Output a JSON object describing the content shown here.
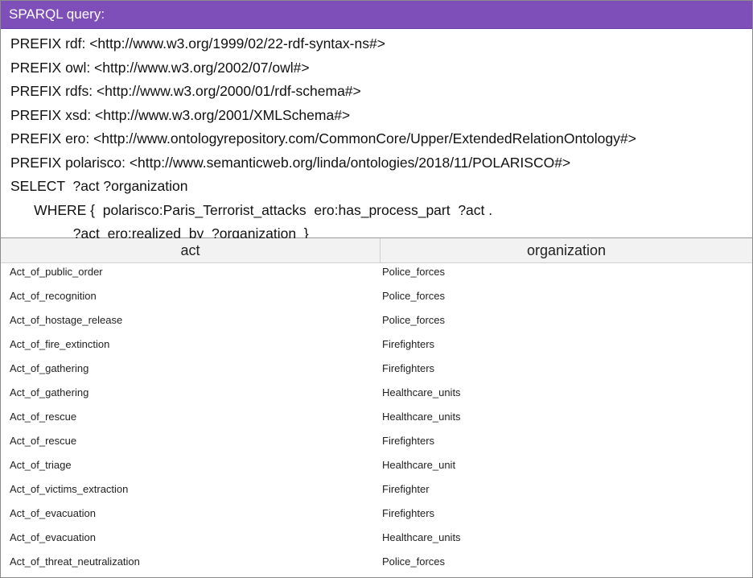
{
  "title": "SPARQL query:",
  "query_lines": [
    "PREFIX rdf: <http://www.w3.org/1999/02/22-rdf-syntax-ns#>",
    "PREFIX owl: <http://www.w3.org/2002/07/owl#>",
    "PREFIX rdfs: <http://www.w3.org/2000/01/rdf-schema#>",
    "PREFIX xsd: <http://www.w3.org/2001/XMLSchema#>",
    "PREFIX ero: <http://www.ontologyrepository.com/CommonCore/Upper/ExtendedRelationOntology#>",
    "PREFIX polarisco: <http://www.semanticweb.org/linda/ontologies/2018/11/POLARISCO#>",
    "SELECT  ?act ?organization",
    "      WHERE {  polarisco:Paris_Terrorist_attacks  ero:has_process_part  ?act .",
    "                ?act  ero:realized_by  ?organization  }"
  ],
  "columns": [
    "act",
    "organization"
  ],
  "rows": [
    [
      "Act_of_public_order",
      "Police_forces"
    ],
    [
      "Act_of_recognition",
      "Police_forces"
    ],
    [
      "Act_of_hostage_release",
      "Police_forces"
    ],
    [
      "Act_of_fire_extinction",
      "Firefighters"
    ],
    [
      "Act_of_gathering",
      "Firefighters"
    ],
    [
      "Act_of_gathering",
      "Healthcare_units"
    ],
    [
      "Act_of_rescue",
      "Healthcare_units"
    ],
    [
      "Act_of_rescue",
      "Firefighters"
    ],
    [
      "Act_of_triage",
      "Healthcare_unit"
    ],
    [
      "Act_of_victims_extraction",
      "Firefighter"
    ],
    [
      "Act_of_evacuation",
      "Firefighters"
    ],
    [
      "Act_of_evacuation",
      "Healthcare_units"
    ],
    [
      "Act_of_threat_neutralization",
      "Police_forces"
    ]
  ],
  "colors": {
    "title_bar": "#7e4fb8",
    "header_bg": "#f2f2f2"
  }
}
